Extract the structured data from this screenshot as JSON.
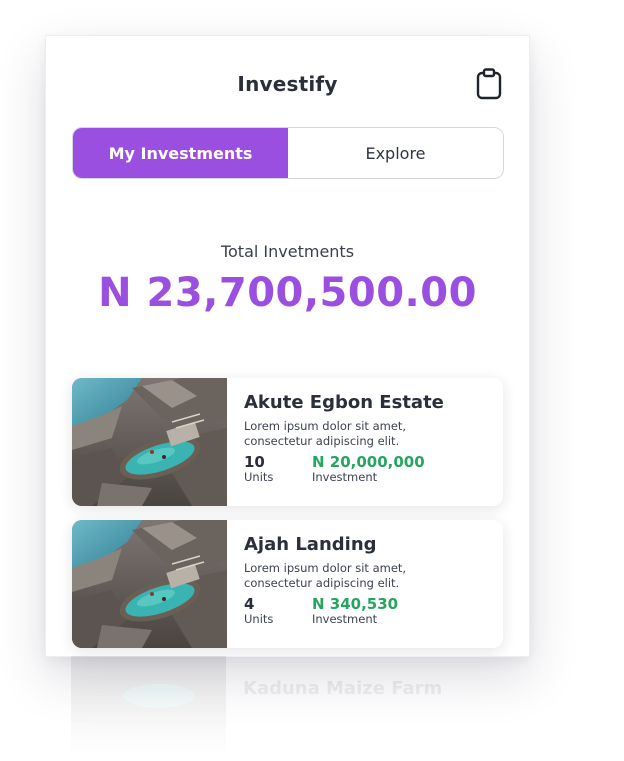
{
  "app": {
    "title": "Investify",
    "header_icon": "clipboard-icon"
  },
  "tabs": [
    {
      "label": "My Investments",
      "active": true
    },
    {
      "label": "Explore",
      "active": false
    }
  ],
  "summary": {
    "label": "Total Invetments",
    "value": "N 23,700,500.00"
  },
  "investments": [
    {
      "title": "Akute Egbon Estate",
      "description": "Lorem ipsum dolor sit amet, consectetur adipiscing elit.",
      "units": "10",
      "units_label": "Units",
      "amount": "N 20,000,000",
      "amount_label": "Investment"
    },
    {
      "title": "Ajah Landing",
      "description": "Lorem ipsum dolor sit amet, consectetur adipiscing elit.",
      "units": "4",
      "units_label": "Units",
      "amount": "N 340,530",
      "amount_label": "Investment"
    }
  ],
  "reflection": {
    "title": "Kaduna Maize Farm"
  },
  "colors": {
    "accent": "#9b4fe0",
    "money": "#25a55f",
    "text": "#2b2f3a"
  }
}
